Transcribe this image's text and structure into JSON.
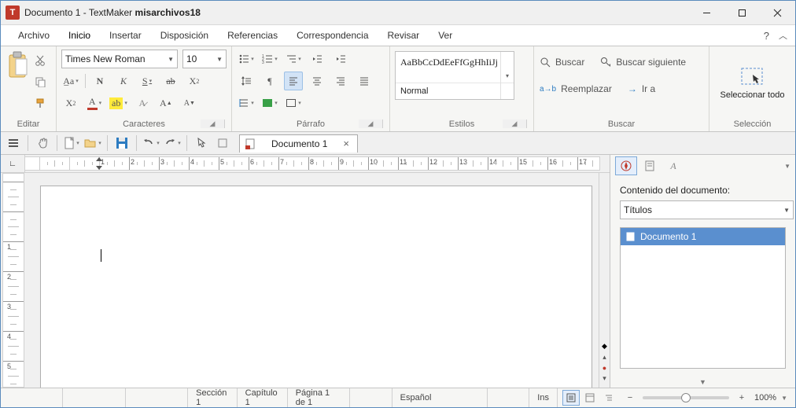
{
  "title": {
    "doc": "Documento 1",
    "app": "TextMaker",
    "profile": "misarchivos18"
  },
  "menu": {
    "items": [
      "Archivo",
      "Inicio",
      "Insertar",
      "Disposición",
      "Referencias",
      "Correspondencia",
      "Revisar",
      "Ver"
    ],
    "activeIndex": 1
  },
  "ribbon": {
    "edit": {
      "label": "Editar"
    },
    "chars": {
      "label": "Caracteres",
      "font": "Times New Roman",
      "size": "10"
    },
    "para": {
      "label": "Párrafo"
    },
    "styles": {
      "label": "Estilos",
      "preview": "AaBbCcDdEeFfGgHhIiJj",
      "name": "Normal"
    },
    "search": {
      "label": "Buscar",
      "find": "Buscar",
      "findnext": "Buscar siguiente",
      "replace": "Reemplazar",
      "goto": "Ir a"
    },
    "select": {
      "label": "Selección",
      "selall": "Seleccionar todo"
    }
  },
  "doctab": {
    "label": "Documento 1"
  },
  "side": {
    "heading": "Contenido del documento:",
    "combo": "Títulos",
    "item": "Documento 1"
  },
  "status": {
    "section": "Sección 1",
    "chapter": "Capítulo 1",
    "page": "Página 1 de 1",
    "lang": "Español",
    "ins": "Ins",
    "zoom": "100%"
  }
}
